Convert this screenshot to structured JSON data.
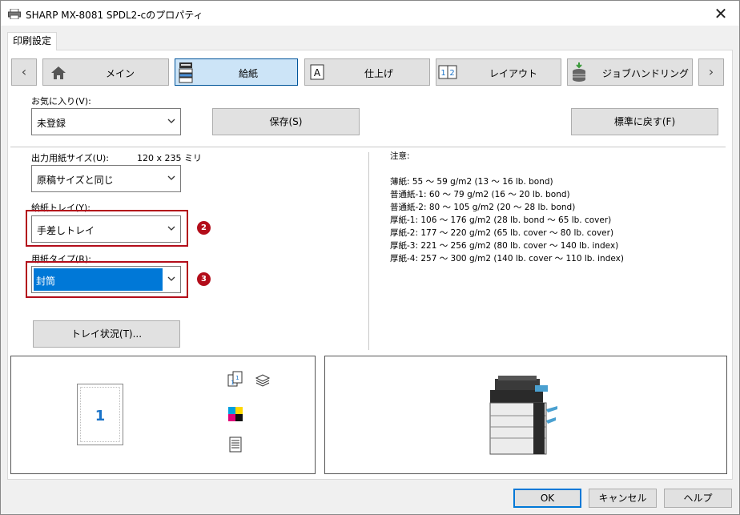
{
  "window": {
    "title": "SHARP MX-8081 SPDL2-cのプロパティ",
    "close_glyph": "✕"
  },
  "tab": {
    "label": "印刷設定"
  },
  "nav": {
    "prev_glyph": "‹",
    "next_glyph": "›",
    "items": [
      {
        "label": "メイン",
        "icon": "home-icon"
      },
      {
        "label": "給紙",
        "icon": "paper-feed-icon",
        "active": true
      },
      {
        "label": "仕上げ",
        "icon": "finishing-icon"
      },
      {
        "label": "レイアウト",
        "icon": "layout-icon"
      },
      {
        "label": "ジョブハンドリング",
        "icon": "job-handling-icon"
      }
    ]
  },
  "favorites": {
    "label": "お気に入り(V):",
    "value": "未登録",
    "save_label": "保存(S)",
    "reset_label": "標準に戻す(F)"
  },
  "output_size": {
    "label": "出力用紙サイズ(U):",
    "dimensions": "120 x 235 ミリ",
    "value": "原稿サイズと同じ"
  },
  "paper_tray": {
    "label": "給紙トレイ(Y):",
    "value": "手差しトレイ",
    "badge": "2"
  },
  "paper_type": {
    "label": "用紙タイプ(R):",
    "value": "封筒",
    "badge": "3"
  },
  "tray_status_label": "トレイ状況(T)...",
  "notes": {
    "heading": "注意:",
    "lines": [
      "薄紙: 55 ～ 59 g/m2 (13 ～ 16 lb. bond)",
      "普通紙-1: 60 ～ 79 g/m2 (16 ～ 20 lb. bond)",
      "普通紙-2: 80 ～ 105 g/m2 (20 ～ 28 lb. bond)",
      "厚紙-1: 106 ～ 176 g/m2 (28 lb. bond ～ 65 lb. cover)",
      "厚紙-2: 177 ～ 220 g/m2 (65 lb. cover ～ 80 lb. cover)",
      "厚紙-3: 221 ～ 256 g/m2 (80 lb. cover ～ 140 lb. index)",
      "厚紙-4: 257 ～ 300 g/m2 (140 lb. cover ～ 110 lb. index)"
    ]
  },
  "preview": {
    "page_number": "1"
  },
  "footer": {
    "ok_label": "OK",
    "cancel_label": "キャンセル",
    "help_label": "ヘルプ"
  },
  "colors": {
    "accent": "#0078d7",
    "active_tab": "#cce4f7",
    "highlight_frame": "#b30d1a",
    "page_number": "#1a73c8"
  }
}
